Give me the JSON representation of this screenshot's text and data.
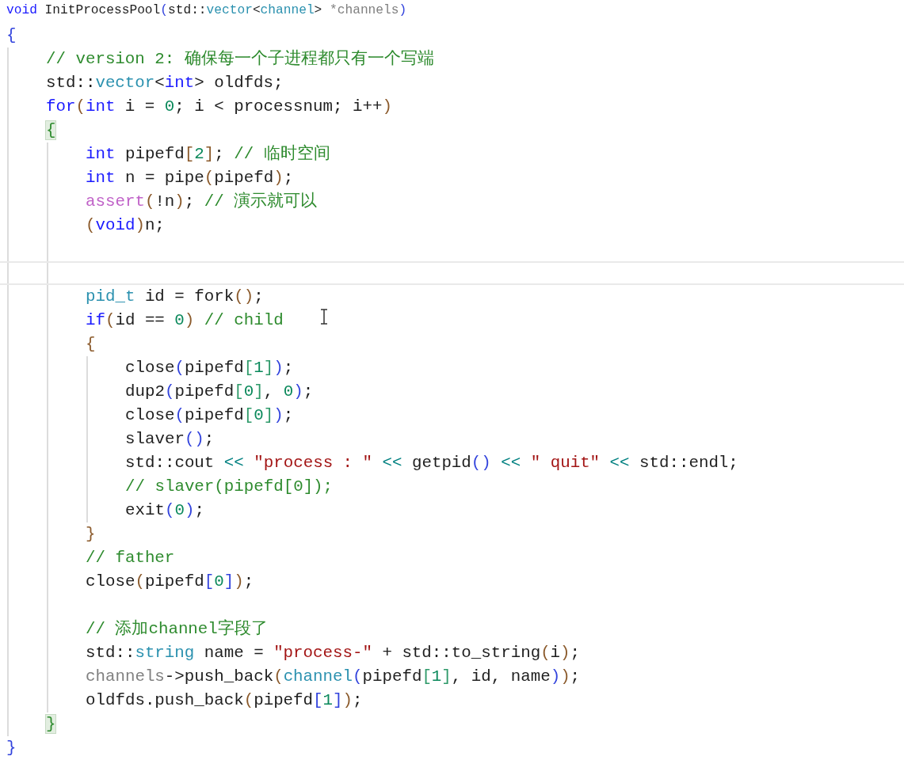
{
  "sticky_header": {
    "tokens": [
      {
        "text": "void",
        "kind": "kw"
      },
      {
        "text": " InitProcessPool",
        "kind": "plain"
      },
      {
        "text": "(",
        "kind": "b2"
      },
      {
        "text": "std::",
        "kind": "plain"
      },
      {
        "text": "vector",
        "kind": "type"
      },
      {
        "text": "<",
        "kind": "plain"
      },
      {
        "text": "channel",
        "kind": "type"
      },
      {
        "text": "> ",
        "kind": "plain"
      },
      {
        "text": "*channels",
        "kind": "param"
      },
      {
        "text": ")",
        "kind": "b2"
      }
    ]
  },
  "lines": [
    {
      "current": false,
      "tokens": [
        {
          "text": "{",
          "kind": "b2"
        }
      ],
      "children": [
        {
          "current": false,
          "tokens": [
            {
              "text": "// version 2: 确保每一个子进程都只有一个写端",
              "kind": "cm"
            }
          ]
        },
        {
          "current": false,
          "tokens": [
            {
              "text": "std::",
              "kind": "plain"
            },
            {
              "text": "vector",
              "kind": "type"
            },
            {
              "text": "<",
              "kind": "plain"
            },
            {
              "text": "int",
              "kind": "kw"
            },
            {
              "text": "> oldfds;",
              "kind": "plain"
            }
          ]
        },
        {
          "current": false,
          "tokens": [
            {
              "text": "for",
              "kind": "kw"
            },
            {
              "text": "(",
              "kind": "b1"
            },
            {
              "text": "int",
              "kind": "kw"
            },
            {
              "text": " i = ",
              "kind": "plain"
            },
            {
              "text": "0",
              "kind": "num"
            },
            {
              "text": "; i < processnum; i++",
              "kind": "plain"
            },
            {
              "text": ")",
              "kind": "b1"
            }
          ]
        },
        {
          "current": false,
          "tokens": [
            {
              "text": "{",
              "kind": "brace_match"
            }
          ],
          "children": [
            {
              "current": false,
              "tokens": [
                {
                  "text": "int",
                  "kind": "kw"
                },
                {
                  "text": " pipefd",
                  "kind": "plain"
                },
                {
                  "text": "[",
                  "kind": "b1"
                },
                {
                  "text": "2",
                  "kind": "num"
                },
                {
                  "text": "]",
                  "kind": "b1"
                },
                {
                  "text": "; ",
                  "kind": "plain"
                },
                {
                  "text": "// 临时空间",
                  "kind": "cm"
                }
              ]
            },
            {
              "current": false,
              "tokens": [
                {
                  "text": "int",
                  "kind": "kw"
                },
                {
                  "text": " n = pipe",
                  "kind": "plain"
                },
                {
                  "text": "(",
                  "kind": "b1"
                },
                {
                  "text": "pipefd",
                  "kind": "plain"
                },
                {
                  "text": ")",
                  "kind": "b1"
                },
                {
                  "text": ";",
                  "kind": "plain"
                }
              ]
            },
            {
              "current": false,
              "tokens": [
                {
                  "text": "assert",
                  "kind": "macro"
                },
                {
                  "text": "(",
                  "kind": "b1"
                },
                {
                  "text": "!n",
                  "kind": "plain"
                },
                {
                  "text": ")",
                  "kind": "b1"
                },
                {
                  "text": "; ",
                  "kind": "plain"
                },
                {
                  "text": "// 演示就可以",
                  "kind": "cm"
                }
              ]
            },
            {
              "current": false,
              "tokens": [
                {
                  "text": "(",
                  "kind": "b1"
                },
                {
                  "text": "void",
                  "kind": "kw"
                },
                {
                  "text": ")",
                  "kind": "b1"
                },
                {
                  "text": "n;",
                  "kind": "plain"
                }
              ]
            },
            {
              "current": false
            },
            {
              "current": true
            },
            {
              "current": false,
              "tokens": [
                {
                  "text": "pid_t",
                  "kind": "type"
                },
                {
                  "text": " id = fork",
                  "kind": "plain"
                },
                {
                  "text": "(",
                  "kind": "b1"
                },
                {
                  "text": ")",
                  "kind": "b1"
                },
                {
                  "text": ";",
                  "kind": "plain"
                }
              ]
            },
            {
              "current": false,
              "tokens": [
                {
                  "text": "if",
                  "kind": "kw"
                },
                {
                  "text": "(",
                  "kind": "b1"
                },
                {
                  "text": "id == ",
                  "kind": "plain"
                },
                {
                  "text": "0",
                  "kind": "num"
                },
                {
                  "text": ")",
                  "kind": "b1"
                },
                {
                  "text": " // child",
                  "kind": "cm"
                }
              ]
            },
            {
              "current": false,
              "tokens": [
                {
                  "text": "{",
                  "kind": "b1"
                }
              ],
              "children": [
                {
                  "current": false,
                  "tokens": [
                    {
                      "text": "close",
                      "kind": "plain"
                    },
                    {
                      "text": "(",
                      "kind": "b2"
                    },
                    {
                      "text": "pipefd",
                      "kind": "plain"
                    },
                    {
                      "text": "[",
                      "kind": "b3"
                    },
                    {
                      "text": "1",
                      "kind": "num"
                    },
                    {
                      "text": "]",
                      "kind": "b3"
                    },
                    {
                      "text": ")",
                      "kind": "b2"
                    },
                    {
                      "text": ";",
                      "kind": "plain"
                    }
                  ]
                },
                {
                  "current": false,
                  "tokens": [
                    {
                      "text": "dup2",
                      "kind": "plain"
                    },
                    {
                      "text": "(",
                      "kind": "b2"
                    },
                    {
                      "text": "pipefd",
                      "kind": "plain"
                    },
                    {
                      "text": "[",
                      "kind": "b3"
                    },
                    {
                      "text": "0",
                      "kind": "num"
                    },
                    {
                      "text": "]",
                      "kind": "b3"
                    },
                    {
                      "text": ", ",
                      "kind": "plain"
                    },
                    {
                      "text": "0",
                      "kind": "num"
                    },
                    {
                      "text": ")",
                      "kind": "b2"
                    },
                    {
                      "text": ";",
                      "kind": "plain"
                    }
                  ]
                },
                {
                  "current": false,
                  "tokens": [
                    {
                      "text": "close",
                      "kind": "plain"
                    },
                    {
                      "text": "(",
                      "kind": "b2"
                    },
                    {
                      "text": "pipefd",
                      "kind": "plain"
                    },
                    {
                      "text": "[",
                      "kind": "b3"
                    },
                    {
                      "text": "0",
                      "kind": "num"
                    },
                    {
                      "text": "]",
                      "kind": "b3"
                    },
                    {
                      "text": ")",
                      "kind": "b2"
                    },
                    {
                      "text": ";",
                      "kind": "plain"
                    }
                  ]
                },
                {
                  "current": false,
                  "tokens": [
                    {
                      "text": "slaver",
                      "kind": "plain"
                    },
                    {
                      "text": "()",
                      "kind": "b2"
                    },
                    {
                      "text": ";",
                      "kind": "plain"
                    }
                  ]
                },
                {
                  "current": false,
                  "tokens": [
                    {
                      "text": "std::cout ",
                      "kind": "plain"
                    },
                    {
                      "text": "<< ",
                      "kind": "op"
                    },
                    {
                      "text": "\"process : \"",
                      "kind": "str"
                    },
                    {
                      "text": " << ",
                      "kind": "op"
                    },
                    {
                      "text": "getpid",
                      "kind": "plain"
                    },
                    {
                      "text": "()",
                      "kind": "b2"
                    },
                    {
                      "text": " << ",
                      "kind": "op"
                    },
                    {
                      "text": "\" quit\"",
                      "kind": "str"
                    },
                    {
                      "text": " << ",
                      "kind": "op"
                    },
                    {
                      "text": "std::endl;",
                      "kind": "plain"
                    }
                  ]
                },
                {
                  "current": false,
                  "tokens": [
                    {
                      "text": "// slaver(pipefd[0]);",
                      "kind": "cm"
                    }
                  ]
                },
                {
                  "current": false,
                  "tokens": [
                    {
                      "text": "exit",
                      "kind": "plain"
                    },
                    {
                      "text": "(",
                      "kind": "b2"
                    },
                    {
                      "text": "0",
                      "kind": "num"
                    },
                    {
                      "text": ")",
                      "kind": "b2"
                    },
                    {
                      "text": ";",
                      "kind": "plain"
                    }
                  ]
                }
              ]
            },
            {
              "current": false,
              "tokens": [
                {
                  "text": "}",
                  "kind": "b1"
                }
              ]
            },
            {
              "current": false,
              "tokens": [
                {
                  "text": "// father",
                  "kind": "cm"
                }
              ]
            },
            {
              "current": false,
              "tokens": [
                {
                  "text": "close",
                  "kind": "plain"
                },
                {
                  "text": "(",
                  "kind": "b1"
                },
                {
                  "text": "pipefd",
                  "kind": "plain"
                },
                {
                  "text": "[",
                  "kind": "b2"
                },
                {
                  "text": "0",
                  "kind": "num"
                },
                {
                  "text": "]",
                  "kind": "b2"
                },
                {
                  "text": ")",
                  "kind": "b1"
                },
                {
                  "text": ";",
                  "kind": "plain"
                }
              ]
            },
            {
              "current": false
            },
            {
              "current": false,
              "tokens": [
                {
                  "text": "// 添加channel字段了",
                  "kind": "cm"
                }
              ]
            },
            {
              "current": false,
              "tokens": [
                {
                  "text": "std::",
                  "kind": "plain"
                },
                {
                  "text": "string",
                  "kind": "type"
                },
                {
                  "text": " name = ",
                  "kind": "plain"
                },
                {
                  "text": "\"process-\"",
                  "kind": "str"
                },
                {
                  "text": " + std::to_string",
                  "kind": "plain"
                },
                {
                  "text": "(",
                  "kind": "b1"
                },
                {
                  "text": "i",
                  "kind": "plain"
                },
                {
                  "text": ")",
                  "kind": "b1"
                },
                {
                  "text": ";",
                  "kind": "plain"
                }
              ]
            },
            {
              "current": false,
              "tokens": [
                {
                  "text": "channels",
                  "kind": "param"
                },
                {
                  "text": "->push_back",
                  "kind": "plain"
                },
                {
                  "text": "(",
                  "kind": "b1"
                },
                {
                  "text": "channel",
                  "kind": "type"
                },
                {
                  "text": "(",
                  "kind": "b2"
                },
                {
                  "text": "pipefd",
                  "kind": "plain"
                },
                {
                  "text": "[",
                  "kind": "b3"
                },
                {
                  "text": "1",
                  "kind": "num"
                },
                {
                  "text": "]",
                  "kind": "b3"
                },
                {
                  "text": ", id, name",
                  "kind": "plain"
                },
                {
                  "text": ")",
                  "kind": "b2"
                },
                {
                  "text": ")",
                  "kind": "b1"
                },
                {
                  "text": ";",
                  "kind": "plain"
                }
              ]
            },
            {
              "current": false,
              "tokens": [
                {
                  "text": "oldfds.push_back",
                  "kind": "plain"
                },
                {
                  "text": "(",
                  "kind": "b1"
                },
                {
                  "text": "pipefd",
                  "kind": "plain"
                },
                {
                  "text": "[",
                  "kind": "b2"
                },
                {
                  "text": "1",
                  "kind": "num"
                },
                {
                  "text": "]",
                  "kind": "b2"
                },
                {
                  "text": ")",
                  "kind": "b1"
                },
                {
                  "text": ";",
                  "kind": "plain"
                }
              ]
            }
          ]
        },
        {
          "current": false,
          "tokens": [
            {
              "text": "}",
              "kind": "brace_match"
            }
          ]
        }
      ]
    },
    {
      "current": false,
      "tokens": [
        {
          "text": "}",
          "kind": "b2"
        }
      ]
    }
  ]
}
